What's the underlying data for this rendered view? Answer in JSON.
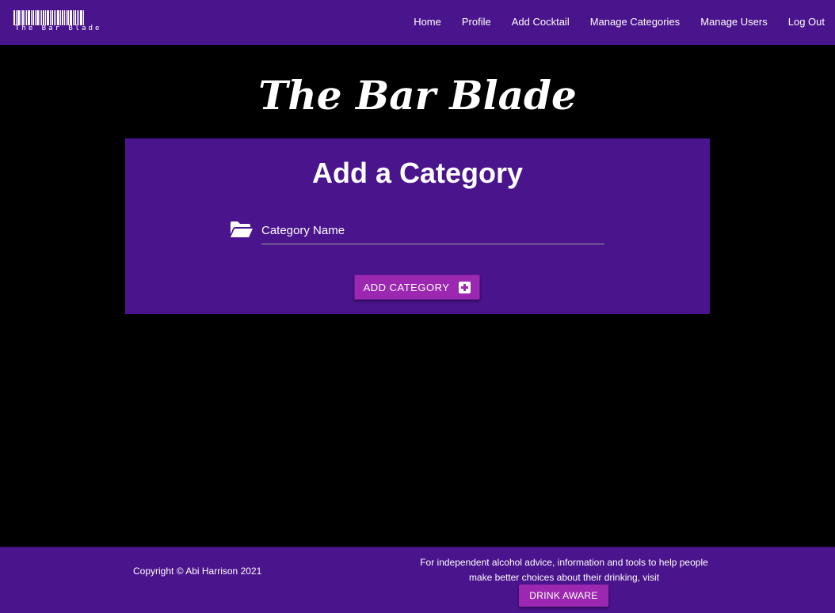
{
  "navbar": {
    "logo_text": "The Bar Blade",
    "links": [
      {
        "label": "Home"
      },
      {
        "label": "Profile"
      },
      {
        "label": "Add Cocktail"
      },
      {
        "label": "Manage Categories"
      },
      {
        "label": "Manage Users"
      },
      {
        "label": "Log Out"
      }
    ]
  },
  "brand_title": "The Bar Blade",
  "form": {
    "title": "Add a Category",
    "field_icon": "folder-open-icon",
    "category_name": {
      "placeholder": "Category Name",
      "value": ""
    },
    "submit_label": "ADD CATEGORY",
    "submit_icon": "plus-square-icon"
  },
  "footer": {
    "copyright": "Copyright © Abi Harrison 2021",
    "advice": "For independent alcohol advice, information and tools to help people make better choices about their drinking, visit",
    "drink_aware_label": "DRINK AWARE"
  },
  "colors": {
    "primary": "#4a148c",
    "accent": "#9c27b0",
    "background": "#000000"
  }
}
